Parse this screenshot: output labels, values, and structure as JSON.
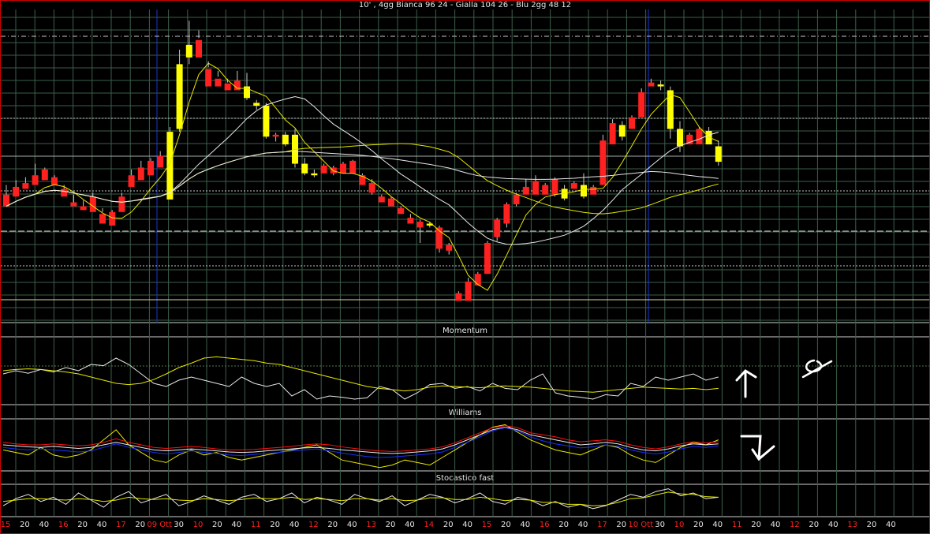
{
  "title": "10' , 4gg Bianca 96 24 - Gialla 104 26 - Blu 2gg 48 12",
  "panels": {
    "momentum": "Momentum",
    "williams": "Williams",
    "stochastic": "Stocastico fast"
  },
  "colors": {
    "background": "#000000",
    "frame": "#d00000",
    "grid": "#3d5e4a",
    "bull_candle": "#ffff00",
    "bear_candle": "#ff2020",
    "white_line": "#e8e8e8",
    "yellow_line": "#e8e800",
    "blue_line": "#1830ff",
    "red_line": "#ff1010",
    "session_line": "#1a35d0",
    "tick_red": "#ff2020",
    "tick_normal": "#e6e6e6"
  },
  "chart_data": [
    {
      "type": "candlestick",
      "title": "10' , 4gg Bianca 96 24 - Gialla 104 26 - Blu 2gg 48 12",
      "moving_averages": [
        "Bianca 96 24",
        "Gialla 104 26",
        "Blu 2gg 48 12"
      ],
      "x_tick_labels": [
        "15",
        "20",
        "40",
        "16",
        "20",
        "40",
        "17",
        "20",
        "09 Ott",
        "30",
        "10",
        "20",
        "40",
        "11",
        "20",
        "40",
        "12",
        "20",
        "40",
        "13",
        "20",
        "40",
        "14",
        "20",
        "40",
        "15",
        "20",
        "40",
        "16",
        "20",
        "40",
        "17",
        "20",
        "10 Ott",
        "30",
        "10",
        "20",
        "40",
        "11",
        "20",
        "40",
        "12",
        "20",
        "40",
        "13",
        "20",
        "40"
      ],
      "red_tick_labels": [
        "15",
        "16",
        "17",
        "09 Ott",
        "10",
        "11",
        "12",
        "13",
        "14",
        "15",
        "16",
        "17",
        "10 Ott",
        "11",
        "12",
        "13"
      ],
      "candles_ohlc_relative": [
        [
          130,
          118,
          122,
          140
        ],
        [
          138,
          128,
          132,
          145
        ],
        [
          142,
          136,
          138,
          148
        ],
        [
          150,
          140,
          142,
          162
        ],
        [
          156,
          145,
          148,
          158
        ],
        [
          148,
          140,
          142,
          150
        ],
        [
          136,
          128,
          130,
          140
        ],
        [
          122,
          118,
          120,
          130
        ],
        [
          118,
          114,
          116,
          124
        ],
        [
          128,
          112,
          114,
          132
        ],
        [
          110,
          100,
          112,
          116
        ],
        [
          112,
          98,
          100,
          114
        ],
        [
          128,
          112,
          128,
          132
        ],
        [
          150,
          138,
          140,
          156
        ],
        [
          158,
          145,
          150,
          165
        ],
        [
          165,
          150,
          152,
          168
        ],
        [
          170,
          158,
          160,
          175
        ],
        [
          125,
          195,
          200,
          128
        ],
        [
          198,
          265,
          280,
          195
        ],
        [
          272,
          285,
          310,
          265
        ],
        [
          290,
          272,
          292,
          300
        ],
        [
          260,
          242,
          262,
          268
        ],
        [
          250,
          242,
          252,
          258
        ],
        [
          245,
          238,
          246,
          250
        ],
        [
          248,
          238,
          242,
          258
        ],
        [
          230,
          242,
          256,
          228
        ],
        [
          222,
          225,
          228,
          218
        ],
        [
          190,
          222,
          225,
          188
        ],
        [
          192,
          190,
          194,
          185
        ],
        [
          182,
          192,
          195,
          180
        ],
        [
          162,
          192,
          198,
          158
        ],
        [
          152,
          162,
          168,
          150
        ],
        [
          150,
          152,
          156,
          148
        ],
        [
          160,
          152,
          162,
          158
        ],
        [
          158,
          152,
          160,
          150
        ],
        [
          162,
          152,
          164,
          152
        ],
        [
          165,
          152,
          166,
          162
        ],
        [
          150,
          140,
          152,
          150
        ],
        [
          142,
          132,
          146,
          130
        ],
        [
          128,
          122,
          130,
          126
        ],
        [
          126,
          118,
          128,
          122
        ],
        [
          116,
          110,
          118,
          110
        ],
        [
          106,
          100,
          110,
          100
        ],
        [
          102,
          96,
          104,
          80
        ],
        [
          98,
          100,
          102,
          96
        ],
        [
          96,
          74,
          98,
          70
        ],
        [
          78,
          72,
          80,
          68
        ],
        [
          28,
          20,
          30,
          22
        ],
        [
          40,
          20,
          44,
          36
        ],
        [
          48,
          36,
          50,
          46
        ],
        [
          80,
          48,
          82,
          56
        ],
        [
          104,
          86,
          106,
          82
        ],
        [
          120,
          100,
          122,
          96
        ],
        [
          130,
          120,
          132,
          118
        ],
        [
          138,
          130,
          146,
          136
        ],
        [
          144,
          130,
          150,
          142
        ],
        [
          140,
          130,
          142,
          136
        ],
        [
          146,
          130,
          148,
          128
        ],
        [
          126,
          136,
          140,
          124
        ],
        [
          142,
          136,
          144,
          140
        ],
        [
          128,
          140,
          152,
          126
        ],
        [
          138,
          130,
          140,
          136
        ],
        [
          186,
          140,
          192,
          182
        ],
        [
          204,
          182,
          208,
          200
        ],
        [
          190,
          202,
          206,
          186
        ],
        [
          210,
          198,
          212,
          208
        ],
        [
          236,
          210,
          240,
          234
        ],
        [
          246,
          242,
          250,
          244
        ],
        [
          242,
          244,
          248,
          238
        ],
        [
          198,
          238,
          242,
          188
        ],
        [
          180,
          198,
          206,
          174
        ],
        [
          192,
          182,
          194,
          186
        ],
        [
          198,
          182,
          200,
          198
        ],
        [
          182,
          196,
          200,
          182
        ],
        [
          164,
          180,
          186,
          160
        ]
      ]
    },
    {
      "type": "line",
      "title": "Momentum",
      "series": [
        {
          "values": [
            0.45,
            0.5,
            0.46,
            0.52,
            0.48,
            0.55,
            0.5,
            0.6,
            0.58,
            0.7,
            0.6,
            0.45,
            0.3,
            0.25,
            0.35,
            0.4,
            0.35,
            0.3,
            0.25,
            0.4,
            0.3,
            0.25,
            0.3,
            0.1,
            0.2,
            0.05,
            0.1,
            0.08,
            0.05,
            0.07,
            0.25,
            0.2,
            0.05,
            0.15,
            0.28,
            0.3,
            0.22,
            0.25,
            0.18,
            0.3,
            0.22,
            0.2,
            0.35,
            0.45,
            0.15,
            0.1,
            0.08,
            0.05,
            0.12,
            0.1,
            0.3,
            0.25,
            0.4,
            0.35,
            0.4,
            0.45,
            0.35,
            0.4
          ]
        },
        {
          "values": [
            0.5,
            0.52,
            0.53,
            0.52,
            0.5,
            0.48,
            0.45,
            0.4,
            0.35,
            0.3,
            0.28,
            0.3,
            0.36,
            0.45,
            0.55,
            0.62,
            0.7,
            0.72,
            0.7,
            0.68,
            0.66,
            0.62,
            0.6,
            0.55,
            0.5,
            0.45,
            0.4,
            0.35,
            0.3,
            0.25,
            0.22,
            0.2,
            0.18,
            0.2,
            0.24,
            0.26,
            0.25,
            0.24,
            0.23,
            0.25,
            0.26,
            0.25,
            0.24,
            0.22,
            0.2,
            0.18,
            0.17,
            0.16,
            0.18,
            0.2,
            0.22,
            0.24,
            0.23,
            0.22,
            0.21,
            0.22,
            0.2,
            0.22
          ]
        }
      ]
    },
    {
      "type": "line",
      "title": "Williams",
      "series": [
        {
          "values": [
            0.4,
            0.35,
            0.3,
            0.45,
            0.3,
            0.25,
            0.3,
            0.4,
            0.6,
            0.8,
            0.5,
            0.35,
            0.2,
            0.15,
            0.3,
            0.4,
            0.3,
            0.35,
            0.25,
            0.2,
            0.25,
            0.3,
            0.35,
            0.4,
            0.45,
            0.5,
            0.35,
            0.2,
            0.15,
            0.1,
            0.05,
            0.1,
            0.2,
            0.15,
            0.1,
            0.25,
            0.4,
            0.55,
            0.7,
            0.85,
            0.9,
            0.75,
            0.6,
            0.5,
            0.4,
            0.35,
            0.3,
            0.4,
            0.5,
            0.45,
            0.3,
            0.2,
            0.15,
            0.3,
            0.45,
            0.55,
            0.5,
            0.6
          ]
        },
        {
          "values": [
            0.5,
            0.48,
            0.46,
            0.45,
            0.47,
            0.45,
            0.43,
            0.45,
            0.5,
            0.55,
            0.5,
            0.45,
            0.4,
            0.38,
            0.4,
            0.42,
            0.4,
            0.38,
            0.36,
            0.35,
            0.36,
            0.38,
            0.4,
            0.42,
            0.44,
            0.45,
            0.43,
            0.4,
            0.38,
            0.36,
            0.34,
            0.33,
            0.34,
            0.36,
            0.38,
            0.42,
            0.5,
            0.6,
            0.7,
            0.8,
            0.85,
            0.8,
            0.7,
            0.65,
            0.6,
            0.55,
            0.5,
            0.52,
            0.55,
            0.52,
            0.45,
            0.4,
            0.38,
            0.42,
            0.48,
            0.52,
            0.5,
            0.52
          ]
        },
        {
          "values": [
            0.55,
            0.52,
            0.5,
            0.5,
            0.52,
            0.5,
            0.48,
            0.5,
            0.55,
            0.62,
            0.55,
            0.5,
            0.45,
            0.43,
            0.45,
            0.47,
            0.45,
            0.42,
            0.4,
            0.4,
            0.41,
            0.43,
            0.45,
            0.47,
            0.5,
            0.52,
            0.5,
            0.46,
            0.43,
            0.4,
            0.38,
            0.37,
            0.38,
            0.4,
            0.42,
            0.46,
            0.54,
            0.64,
            0.74,
            0.84,
            0.88,
            0.84,
            0.74,
            0.7,
            0.66,
            0.6,
            0.56,
            0.58,
            0.6,
            0.57,
            0.5,
            0.45,
            0.42,
            0.46,
            0.52,
            0.56,
            0.54,
            0.56
          ]
        },
        {
          "values": [
            0.45,
            0.42,
            0.4,
            0.42,
            0.4,
            0.38,
            0.36,
            0.38,
            0.45,
            0.52,
            0.45,
            0.4,
            0.35,
            0.32,
            0.35,
            0.38,
            0.35,
            0.33,
            0.3,
            0.29,
            0.31,
            0.33,
            0.35,
            0.38,
            0.4,
            0.42,
            0.38,
            0.34,
            0.3,
            0.27,
            0.25,
            0.26,
            0.28,
            0.3,
            0.32,
            0.36,
            0.45,
            0.55,
            0.66,
            0.78,
            0.84,
            0.78,
            0.66,
            0.58,
            0.52,
            0.48,
            0.44,
            0.46,
            0.5,
            0.47,
            0.4,
            0.35,
            0.32,
            0.36,
            0.42,
            0.47,
            0.45,
            0.48
          ]
        }
      ]
    },
    {
      "type": "line",
      "title": "Stocastico fast",
      "series": [
        {
          "values": [
            0.3,
            0.55,
            0.7,
            0.45,
            0.6,
            0.35,
            0.75,
            0.5,
            0.25,
            0.6,
            0.8,
            0.4,
            0.55,
            0.7,
            0.3,
            0.45,
            0.65,
            0.5,
            0.35,
            0.6,
            0.7,
            0.45,
            0.55,
            0.75,
            0.4,
            0.6,
            0.5,
            0.35,
            0.7,
            0.55,
            0.45,
            0.65,
            0.3,
            0.5,
            0.7,
            0.6,
            0.4,
            0.55,
            0.75,
            0.45,
            0.35,
            0.6,
            0.5,
            0.3,
            0.45,
            0.25,
            0.35,
            0.2,
            0.3,
            0.5,
            0.7,
            0.6,
            0.8,
            0.9,
            0.65,
            0.75,
            0.55,
            0.6
          ]
        },
        {
          "values": [
            0.45,
            0.5,
            0.55,
            0.55,
            0.52,
            0.5,
            0.55,
            0.52,
            0.45,
            0.5,
            0.6,
            0.55,
            0.52,
            0.55,
            0.5,
            0.48,
            0.55,
            0.52,
            0.48,
            0.52,
            0.58,
            0.55,
            0.55,
            0.6,
            0.52,
            0.55,
            0.52,
            0.48,
            0.55,
            0.55,
            0.5,
            0.55,
            0.48,
            0.5,
            0.58,
            0.58,
            0.52,
            0.52,
            0.6,
            0.55,
            0.48,
            0.52,
            0.5,
            0.42,
            0.42,
            0.35,
            0.35,
            0.3,
            0.32,
            0.42,
            0.55,
            0.58,
            0.68,
            0.78,
            0.72,
            0.7,
            0.62,
            0.6
          ]
        }
      ]
    }
  ]
}
